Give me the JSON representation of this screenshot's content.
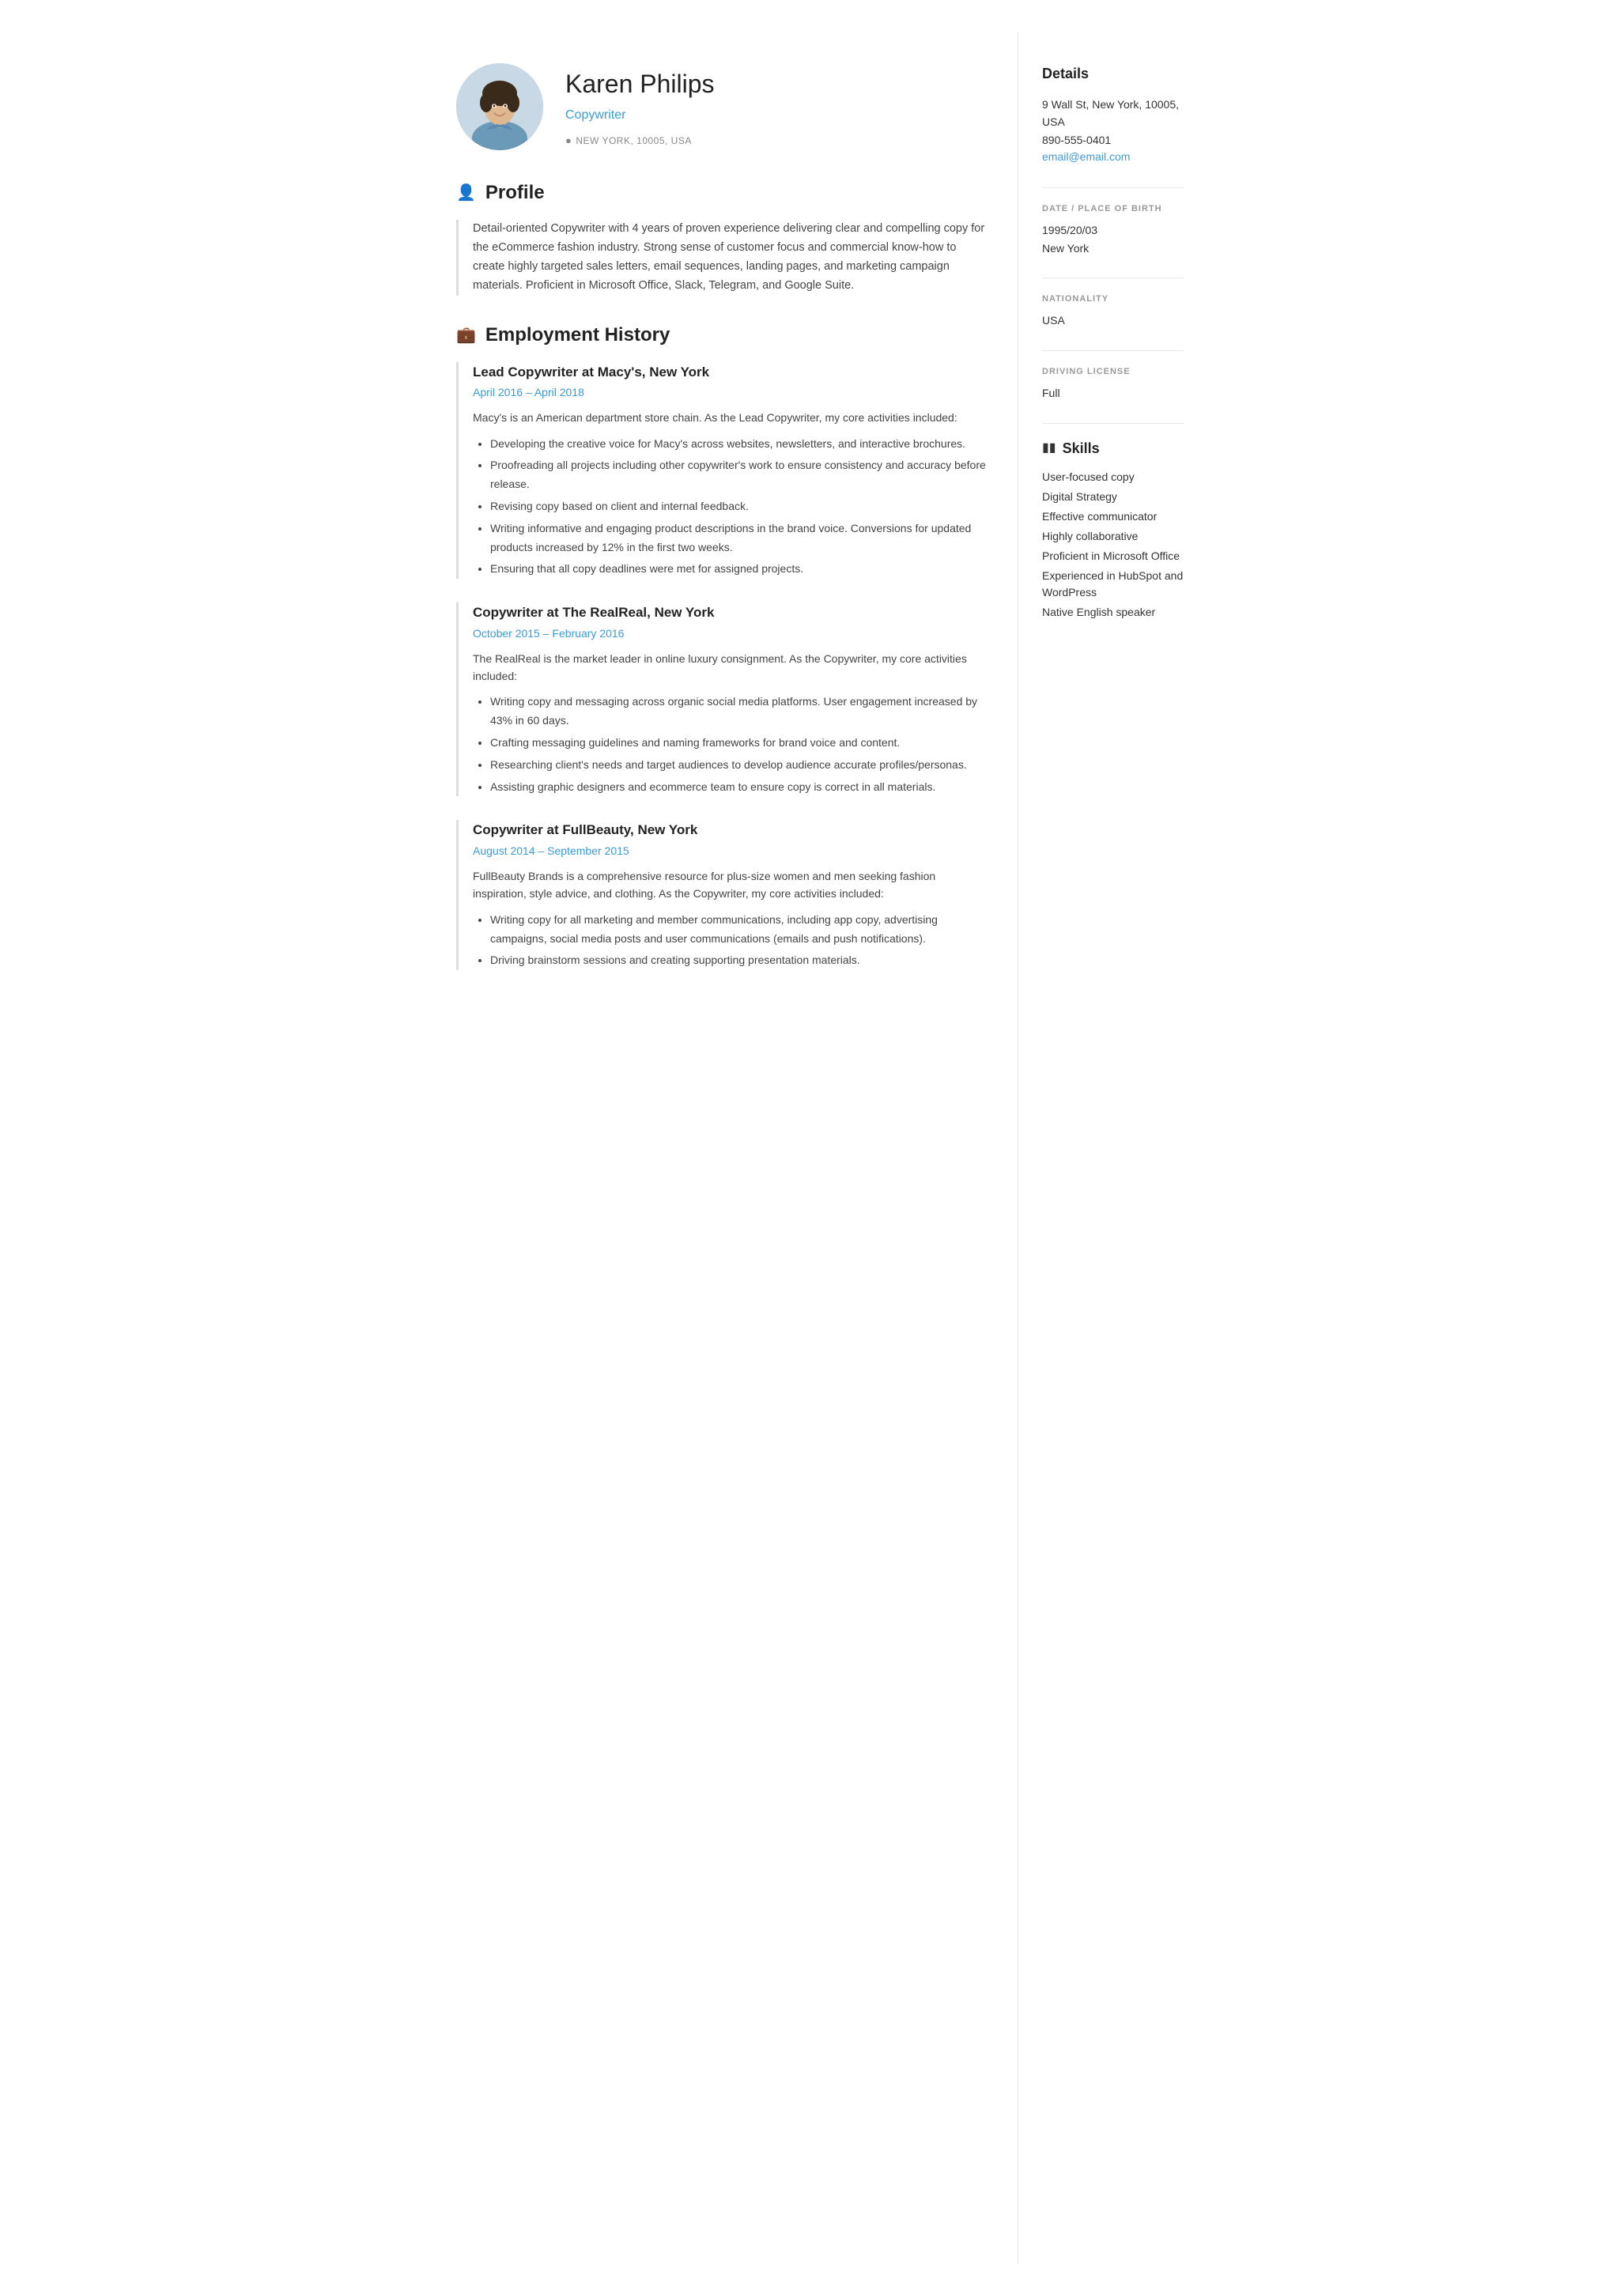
{
  "header": {
    "name": "Karen Philips",
    "title": "Copywriter",
    "location": "NEW YORK, 10005, USA"
  },
  "sidebar": {
    "details_title": "Details",
    "address": "9 Wall St, New York, 10005, USA",
    "phone": "890-555-0401",
    "email": "email@email.com",
    "dob_label": "DATE / PLACE OF BIRTH",
    "dob": "1995/20/03",
    "birthplace": "New York",
    "nationality_label": "NATIONALITY",
    "nationality": "USA",
    "driving_label": "DRIVING LICENSE",
    "driving": "Full",
    "skills_title": "Skills",
    "skills": [
      "User-focused copy",
      "Digital Strategy",
      "Effective communicator",
      "Highly collaborative",
      "Proficient in Microsoft Office",
      "Experienced in HubSpot and WordPress",
      "Native English speaker"
    ]
  },
  "profile": {
    "section_title": "Profile",
    "body": "Detail-oriented Copywriter with 4 years of proven experience delivering clear and compelling copy for the eCommerce fashion industry. Strong sense of customer focus and commercial know-how to create highly targeted sales letters, email sequences, landing pages, and marketing campaign materials. Proficient in Microsoft Office, Slack, Telegram, and Google Suite."
  },
  "employment": {
    "section_title": "Employment History",
    "jobs": [
      {
        "title": "Lead Copywriter at Macy's, New York",
        "dates": "April 2016  –  April 2018",
        "description": "Macy's is an American department store chain. As the Lead Copywriter, my core activities included:",
        "bullets": [
          "Developing the creative voice for Macy's across websites, newsletters, and interactive brochures.",
          "Proofreading all projects including other copywriter's work to ensure consistency and accuracy before release.",
          "Revising copy based on client and internal feedback.",
          "Writing informative and engaging product descriptions in the brand voice. Conversions for updated products increased by 12% in the first two weeks.",
          "Ensuring that all copy deadlines were met for assigned projects."
        ]
      },
      {
        "title": "Copywriter at The RealReal, New York",
        "dates": "October 2015  –  February 2016",
        "description": "The RealReal is the market leader in online luxury consignment. As the Copywriter, my core activities included:",
        "bullets": [
          "Writing copy and messaging across organic social media platforms. User engagement increased by 43% in 60 days.",
          "Crafting messaging guidelines and naming frameworks for brand voice and content.",
          "Researching client's needs and target audiences to develop audience accurate profiles/personas.",
          "Assisting graphic designers and ecommerce team to ensure copy is correct in all materials."
        ]
      },
      {
        "title": "Copywriter at FullBeauty, New York",
        "dates": "August 2014  –  September 2015",
        "description": "FullBeauty Brands is a comprehensive resource for plus-size women and men seeking fashion inspiration, style advice, and clothing. As the Copywriter, my core activities included:",
        "bullets": [
          "Writing copy for all marketing and member communications, including app copy, advertising campaigns, social media posts and user communications (emails and push notifications).",
          "Driving brainstorm sessions and creating supporting presentation materials."
        ]
      }
    ]
  }
}
